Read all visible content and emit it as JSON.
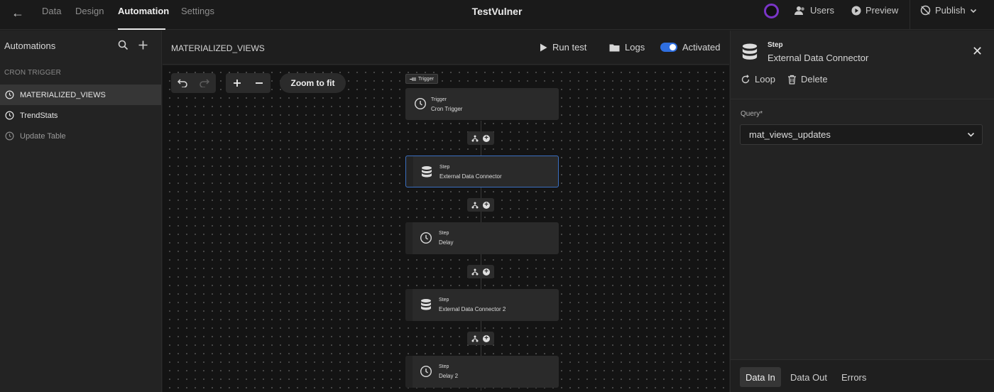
{
  "topbar": {
    "nav_tabs": [
      "Data",
      "Design",
      "Automation",
      "Settings"
    ],
    "active_tab": "Automation",
    "app_title": "TestVulner",
    "users_label": "Users",
    "preview_label": "Preview",
    "publish_label": "Publish"
  },
  "sidebar": {
    "header": "Automations",
    "section_title": "CRON TRIGGER",
    "items": [
      {
        "label": "MATERIALIZED_VIEWS",
        "selected": true
      },
      {
        "label": "TrendStats",
        "selected": false
      },
      {
        "label": "Update Table",
        "selected": false
      }
    ]
  },
  "canvas_header": {
    "title": "MATERIALIZED_VIEWS",
    "run_test_label": "Run test",
    "logs_label": "Logs",
    "activated_label": "Activated",
    "activated": true
  },
  "canvas": {
    "zoom_to_fit_label": "Zoom to fit",
    "trigger_tag": "Trigger",
    "nodes": [
      {
        "kind": "Trigger",
        "name": "Cron Trigger",
        "icon": "clock-icon"
      },
      {
        "kind": "Step",
        "name": "External Data Connector",
        "icon": "database-icon",
        "selected": true
      },
      {
        "kind": "Step",
        "name": "Delay",
        "icon": "clock-icon"
      },
      {
        "kind": "Step",
        "name": "External Data Connector 2",
        "icon": "database-icon"
      },
      {
        "kind": "Step",
        "name": "Delay 2",
        "icon": "clock-icon"
      }
    ]
  },
  "panel": {
    "kind": "Step",
    "name": "External Data Connector",
    "loop_label": "Loop",
    "delete_label": "Delete",
    "query_label": "Query*",
    "query_value": "mat_views_updates",
    "bottom_tabs": [
      "Data In",
      "Data Out",
      "Errors"
    ],
    "active_bottom_tab": "Data In"
  },
  "colors": {
    "accent": "#2f6fe0",
    "avatar_ring": "#7a35c7",
    "selected_node_border": "#3a6fc0"
  }
}
